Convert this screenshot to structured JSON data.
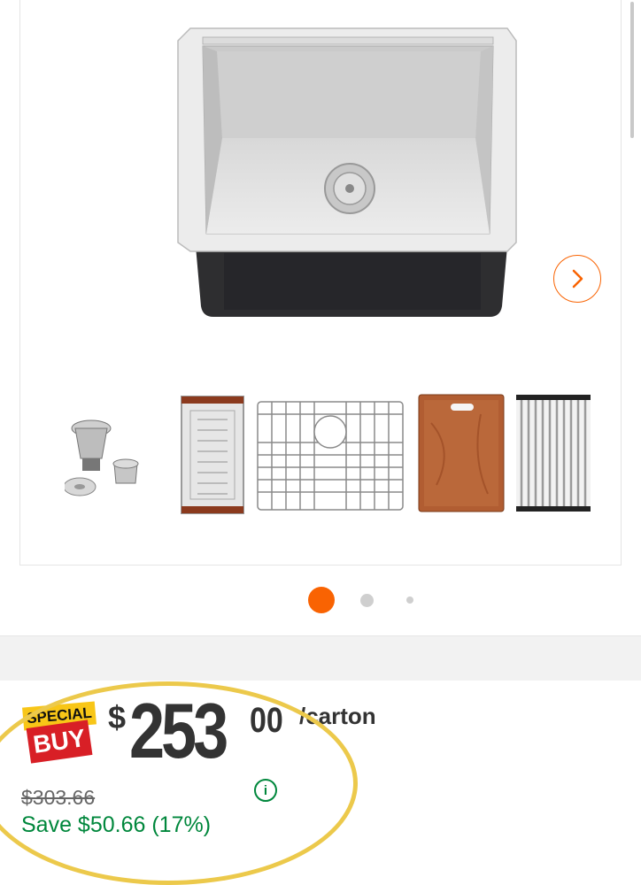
{
  "gallery": {
    "main_image": "stainless-steel-undermount-sink",
    "accessory_images": [
      "drain-strainer-assembly",
      "colander",
      "bottom-grid",
      "cutting-board",
      "roll-up-drying-rack"
    ],
    "next_icon": "chevron-right-icon",
    "pagination": {
      "total": 3,
      "active": 1
    }
  },
  "pricing": {
    "badge_top": "SPECIAL",
    "badge_bottom": "BUY",
    "currency": "$",
    "dollars": "253",
    "cents": "00",
    "unit": "/carton",
    "was_price": "$303.66",
    "savings": "Save $50.66 (17%)",
    "info_icon": "i"
  },
  "colors": {
    "accent_orange": "#f96302",
    "savings_green": "#00873c",
    "badge_yellow": "#f8c617",
    "badge_red": "#d81f26",
    "highlight_yellow": "#ecc94b"
  }
}
